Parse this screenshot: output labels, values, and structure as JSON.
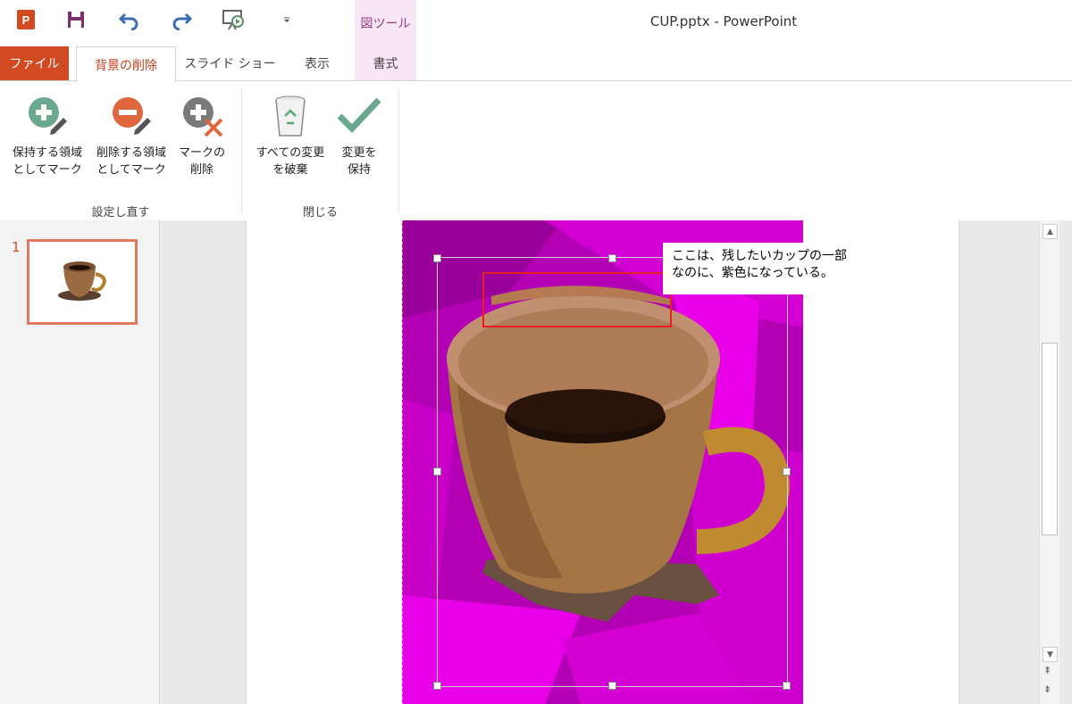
{
  "window": {
    "title": "CUP.pptx - PowerPoint",
    "context_tool_label": "図ツール"
  },
  "quick_access": [
    "app-icon",
    "save-icon",
    "undo-icon",
    "redo-icon",
    "start-slideshow-icon",
    "customize-qat-icon"
  ],
  "tabs": {
    "file": "ファイル",
    "background_removal": "背景の削除",
    "slideshow": "スライド ショー",
    "view": "表示",
    "format": "書式"
  },
  "ribbon": {
    "mark_keep": [
      "保持する領域",
      "としてマーク"
    ],
    "mark_remove": [
      "削除する領域",
      "としてマーク"
    ],
    "delete_mark": [
      "マークの",
      "削除"
    ],
    "discard_all": [
      "すべての変更",
      "を破棄"
    ],
    "keep_changes": [
      "変更を",
      "保持"
    ],
    "group_refine": "設定し直す",
    "group_close": "閉じる"
  },
  "slides": {
    "current_number": "1"
  },
  "annotation": {
    "line1": "ここは、残したいカップの一部",
    "line2": "なのに、紫色になっている。"
  },
  "colors": {
    "accent": "#d14a22",
    "context_tab": "#f7e6f3",
    "removal_overlay": "#e800e8",
    "highlight_box": "#e62020"
  }
}
